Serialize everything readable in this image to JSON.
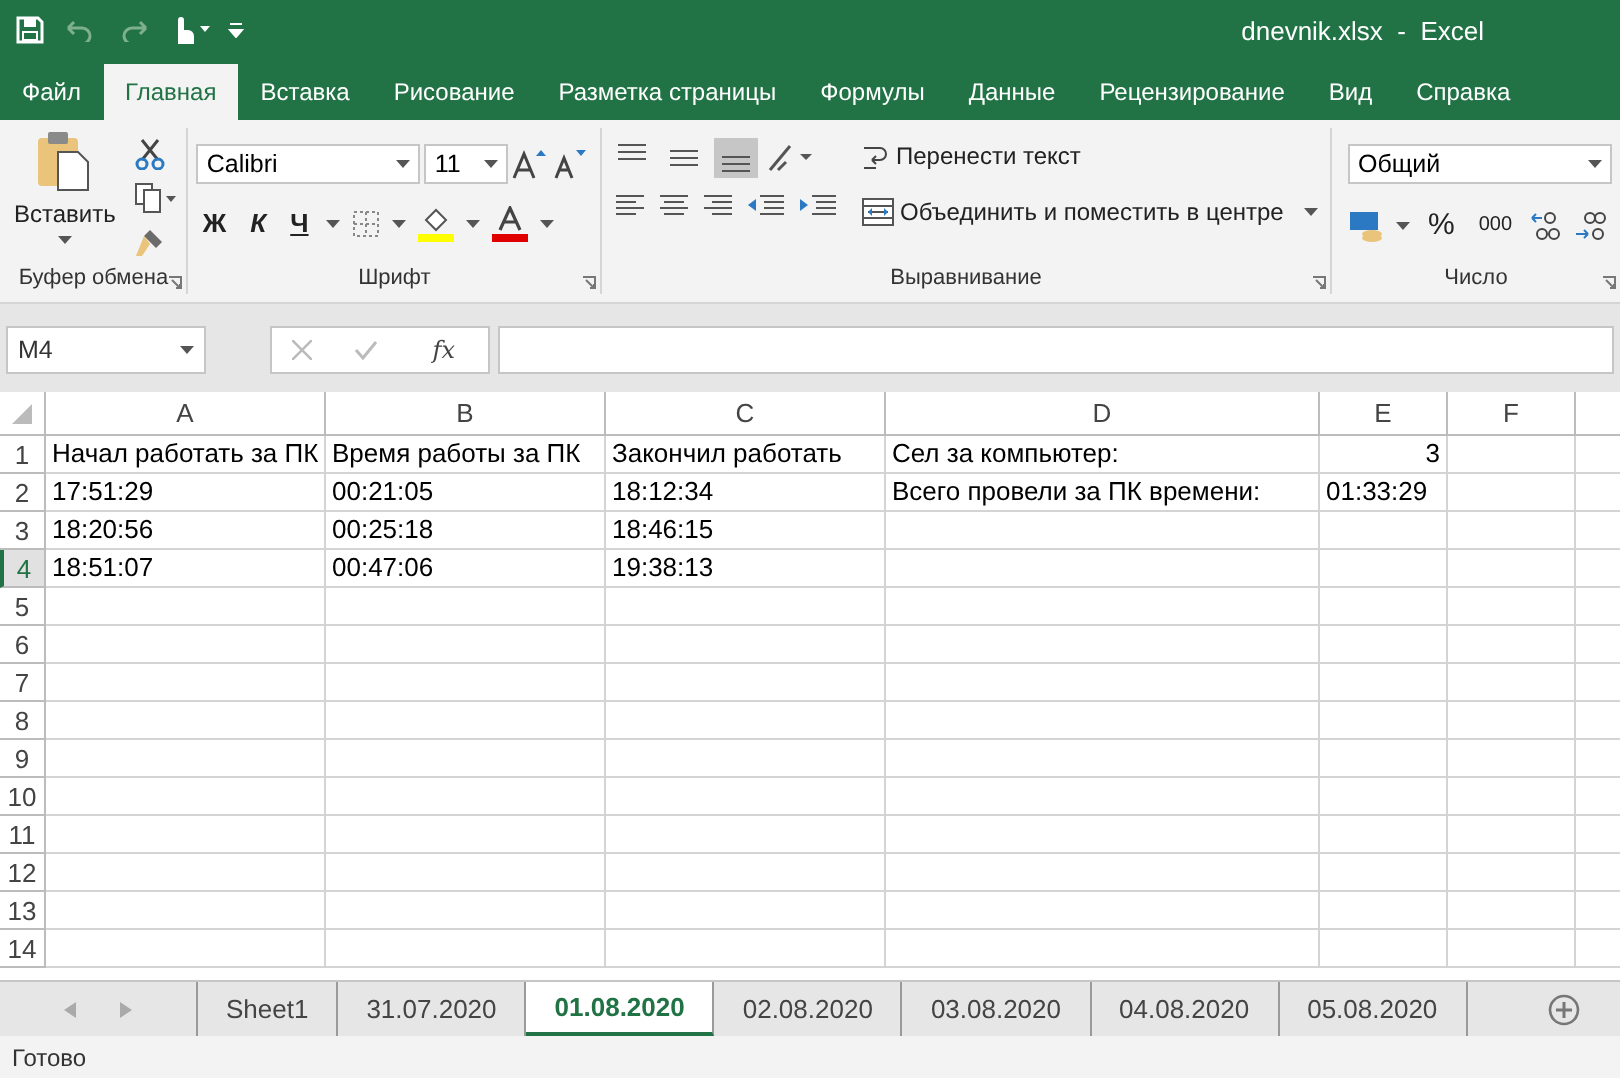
{
  "window": {
    "title": "dnevnik.xlsx  -  Excel"
  },
  "ribbon_tabs": [
    {
      "label": "Файл",
      "selected": false
    },
    {
      "label": "Главная",
      "selected": true
    },
    {
      "label": "Вставка",
      "selected": false
    },
    {
      "label": "Рисование",
      "selected": false
    },
    {
      "label": "Разметка страницы",
      "selected": false
    },
    {
      "label": "Формулы",
      "selected": false
    },
    {
      "label": "Данные",
      "selected": false
    },
    {
      "label": "Рецензирование",
      "selected": false
    },
    {
      "label": "Вид",
      "selected": false
    },
    {
      "label": "Справка",
      "selected": false
    }
  ],
  "ribbon": {
    "clipboard": {
      "paste": "Вставить",
      "label": "Буфер обмена"
    },
    "font": {
      "family": "Calibri",
      "size": "11",
      "bold": "Ж",
      "italic": "К",
      "underline": "Ч",
      "label": "Шрифт"
    },
    "alignment": {
      "vertical": [
        {
          "selected": false
        },
        {
          "selected": false
        },
        {
          "selected": true
        }
      ],
      "wrap": "Перенести текст",
      "merge": "Объединить и поместить в центре",
      "label": "Выравнивание"
    },
    "number": {
      "format": "Общий",
      "percent": "%",
      "thousands": "000",
      "label": "Число"
    }
  },
  "formula_bar": {
    "name_box": "M4",
    "fx": "fx"
  },
  "grid": {
    "columns": [
      "A",
      "B",
      "C",
      "D",
      "E",
      "F"
    ],
    "rows": [
      {
        "number": "1",
        "selected": false,
        "cells": {
          "A": {
            "text": "Начал работать за ПК"
          },
          "B": {
            "text": "Время работы за ПК"
          },
          "C": {
            "text": "Закончил работать"
          },
          "D": {
            "text": "Сел за компьютер:"
          },
          "E": {
            "text": "3",
            "numeric": true
          }
        }
      },
      {
        "number": "2",
        "selected": false,
        "cells": {
          "A": {
            "text": "17:51:29"
          },
          "B": {
            "text": "00:21:05"
          },
          "C": {
            "text": "18:12:34"
          },
          "D": {
            "text": "Всего провели за ПК времени:"
          },
          "E": {
            "text": "01:33:29"
          }
        }
      },
      {
        "number": "3",
        "selected": false,
        "cells": {
          "A": {
            "text": "18:20:56"
          },
          "B": {
            "text": "00:25:18"
          },
          "C": {
            "text": "18:46:15"
          }
        }
      },
      {
        "number": "4",
        "selected": true,
        "cells": {
          "A": {
            "text": "18:51:07"
          },
          "B": {
            "text": "00:47:06"
          },
          "C": {
            "text": "19:38:13"
          }
        }
      },
      {
        "number": "5",
        "selected": false
      },
      {
        "number": "6",
        "selected": false
      },
      {
        "number": "7",
        "selected": false
      },
      {
        "number": "8",
        "selected": false
      },
      {
        "number": "9",
        "selected": false
      },
      {
        "number": "10",
        "selected": false
      },
      {
        "number": "11",
        "selected": false
      },
      {
        "number": "12",
        "selected": false
      },
      {
        "number": "13",
        "selected": false
      },
      {
        "number": "14",
        "selected": false
      }
    ]
  },
  "sheet_tabs": [
    {
      "label": "Sheet1",
      "selected": false
    },
    {
      "label": "31.07.2020",
      "selected": false
    },
    {
      "label": "01.08.2020",
      "selected": true
    },
    {
      "label": "02.08.2020",
      "selected": false
    },
    {
      "label": "03.08.2020",
      "selected": false
    },
    {
      "label": "04.08.2020",
      "selected": false
    },
    {
      "label": "05.08.2020",
      "selected": false
    }
  ],
  "status_bar": {
    "text": "Готово"
  }
}
